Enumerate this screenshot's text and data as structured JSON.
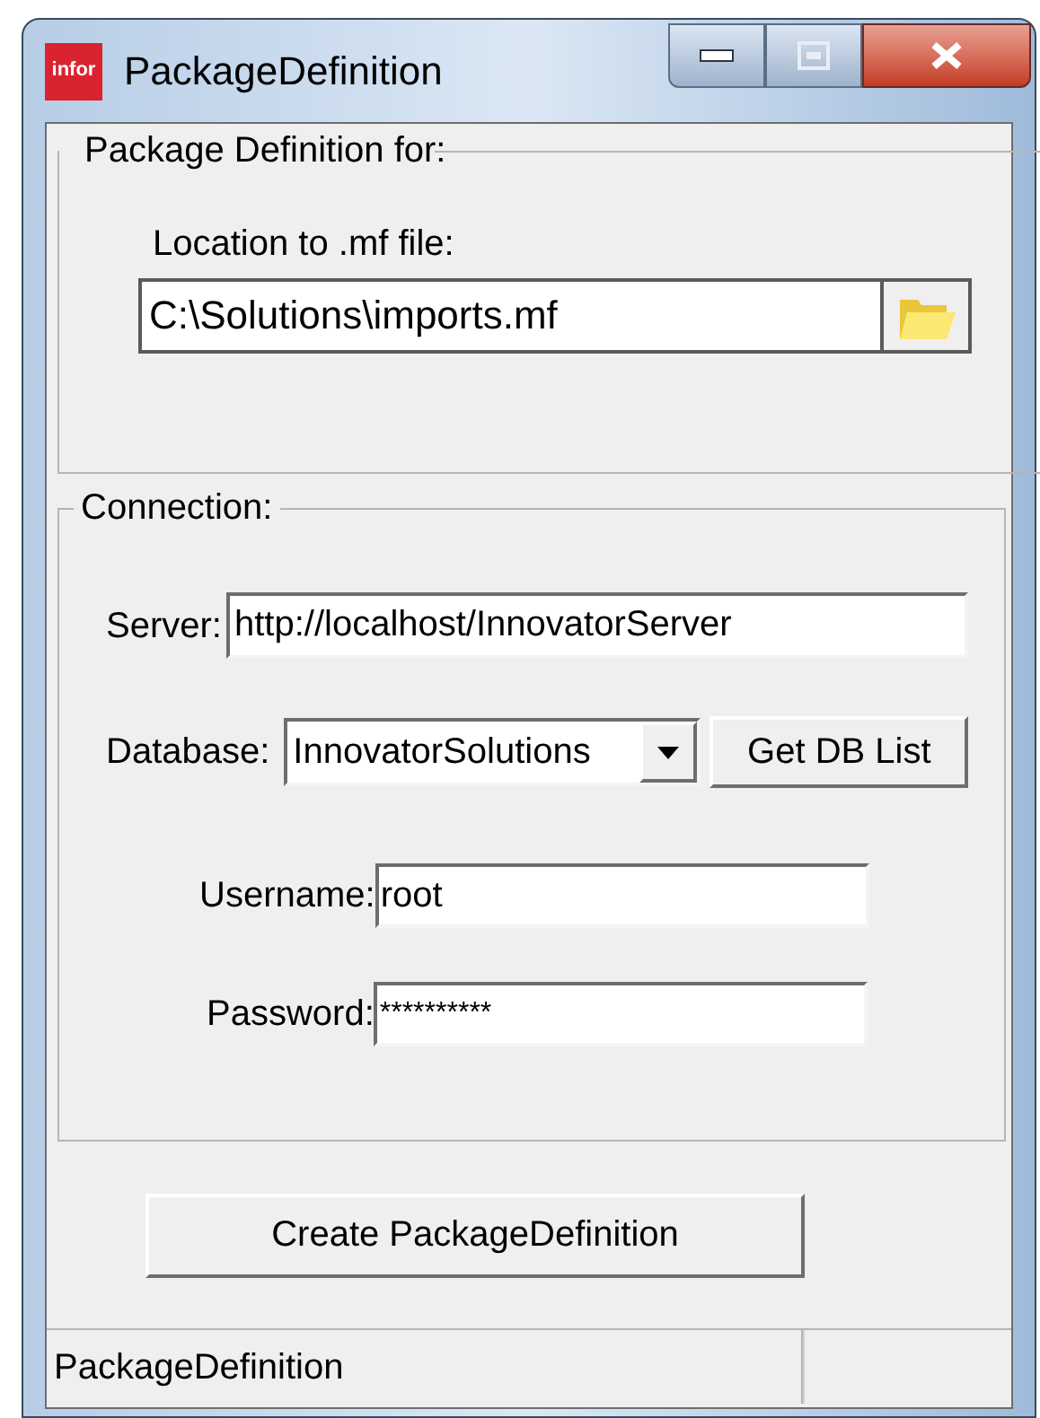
{
  "window": {
    "title": "PackageDefinition",
    "logo": "infor"
  },
  "package_group": {
    "legend": "Package Definition for:",
    "location_label": "Location to .mf file:",
    "location_value": "C:\\Solutions\\imports.mf"
  },
  "connection_group": {
    "legend": "Connection:",
    "server_label": "Server:",
    "server_value": "http://localhost/InnovatorServer",
    "database_label": "Database:",
    "database_value": "InnovatorSolutions",
    "get_db_button": "Get DB List",
    "username_label": "Username:",
    "username_value": "root",
    "password_label": "Password:",
    "password_value": "**********"
  },
  "create_button": "Create PackageDefinition",
  "status_bar": {
    "text": "PackageDefinition"
  }
}
